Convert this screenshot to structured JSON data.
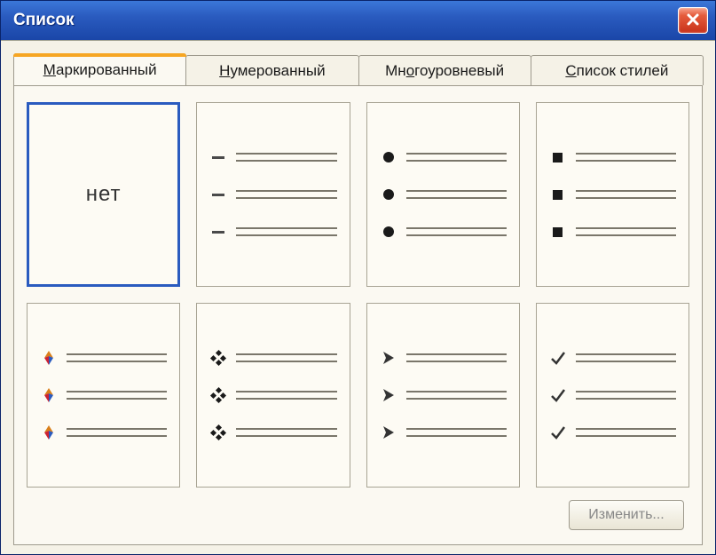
{
  "window": {
    "title": "Список"
  },
  "tabs": [
    {
      "label_pre": "",
      "ul": "М",
      "label_post": "аркированный",
      "active": true
    },
    {
      "label_pre": "",
      "ul": "Н",
      "label_post": "умерованный",
      "active": false
    },
    {
      "label_pre": "Мн",
      "ul": "о",
      "label_post": "гоуровневый",
      "active": false
    },
    {
      "label_pre": "",
      "ul": "С",
      "label_post": "писок стилей",
      "active": false
    }
  ],
  "none_label": "нет",
  "options": [
    {
      "kind": "none",
      "selected": true
    },
    {
      "kind": "dash",
      "selected": false
    },
    {
      "kind": "disc",
      "selected": false
    },
    {
      "kind": "square",
      "selected": false
    },
    {
      "kind": "colorarrow",
      "selected": false
    },
    {
      "kind": "fourdot",
      "selected": false
    },
    {
      "kind": "arrowhead",
      "selected": false
    },
    {
      "kind": "checkmark",
      "selected": false
    }
  ],
  "buttons": {
    "change": "Изменить..."
  }
}
